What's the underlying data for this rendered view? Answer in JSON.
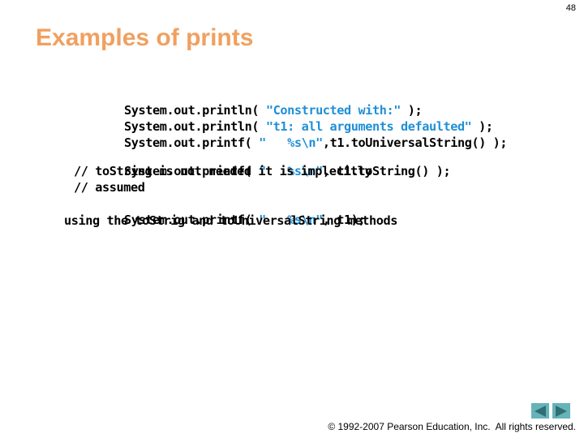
{
  "slide": {
    "number": "48",
    "title": "Examples of prints"
  },
  "code": {
    "lines": [
      {
        "prefix": "System.out.println( ",
        "string": "\"Constructed with:\"",
        "suffix": " );"
      },
      {
        "prefix": "System.out.println( ",
        "string": "\"t1: all arguments defaulted\"",
        "suffix": " );"
      },
      {
        "prefix": "System.out.printf( ",
        "string": "\"   %s\\n\"",
        "suffix": ",t1.toUniversalString() );"
      },
      {
        "prefix": "System.out.printf( ",
        "string": "\"   %s\\n\"",
        "suffix": ", t1.toString() );"
      },
      {
        "text": "// toString is not needed it is implecitly"
      },
      {
        "text": "// assumed"
      },
      {
        "prefix": "System.out.printf( ",
        "string": "\"   %s\\n\"",
        "suffix": ", t1);"
      },
      {
        "text": "using the toStrig and toUniversalString methods"
      }
    ]
  },
  "navigation": {
    "previous_icon": "triangle-left-icon",
    "next_icon": "triangle-right-icon"
  },
  "footer": {
    "copyright": "© 1992-2007 Pearson Education, Inc.  All rights reserved."
  },
  "colors": {
    "title": "#f0a060",
    "string_literal": "#1f8fd6",
    "nav_button_bg": "#66b3b8",
    "nav_button_arrow": "#2f6f74"
  }
}
